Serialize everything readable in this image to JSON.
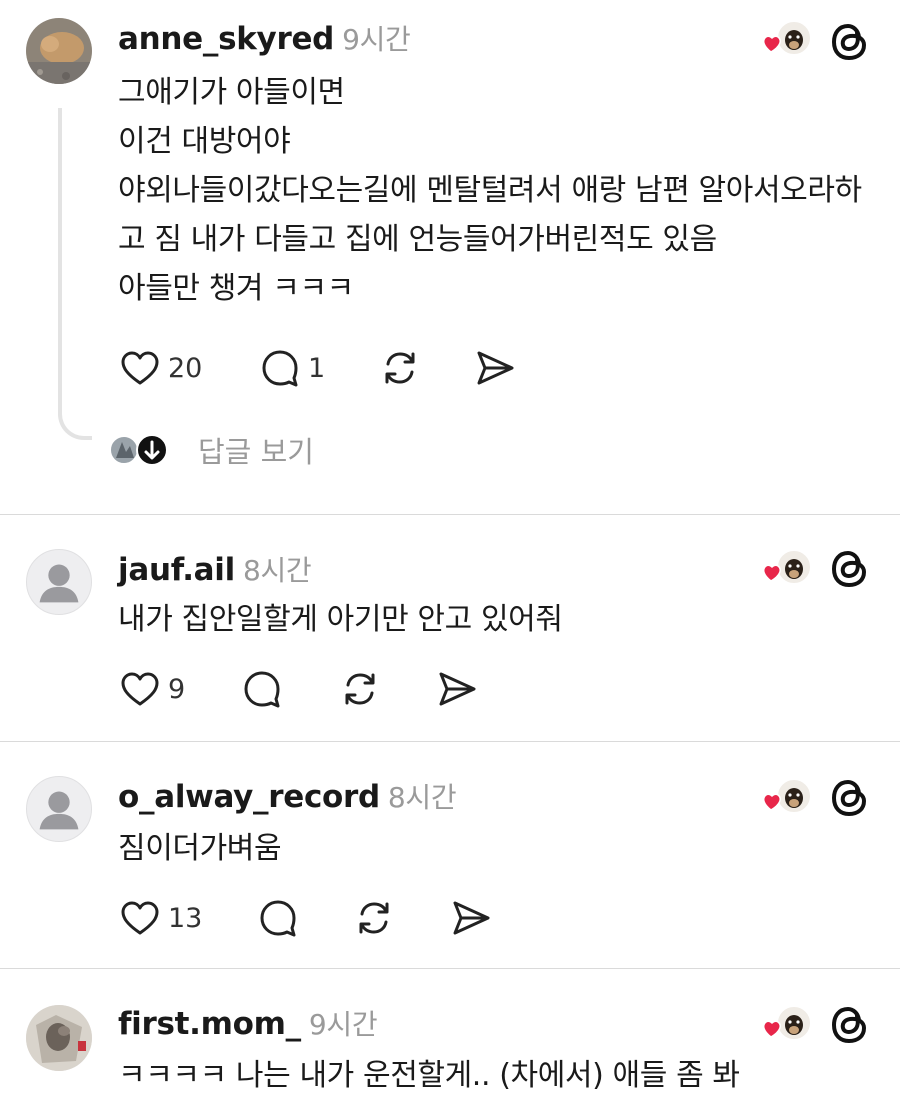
{
  "posts": [
    {
      "username": "anne_skyred",
      "time": "9시간",
      "text": "그애기가 아들이면\n이건 대방어야\n야외나들이갔다오는길에 멘탈털려서 애랑 남편 알아서오라하고 짐 내가 다들고 집에 언능들어가버린적도 있음\n아들만 챙겨 ㅋㅋㅋ",
      "likes": "20",
      "replies": "1",
      "view_replies_label": "답글 보기"
    },
    {
      "username": "jauf.ail",
      "time": "8시간",
      "text": "내가 집안일할게 아기만 안고 있어줘",
      "likes": "9",
      "replies": ""
    },
    {
      "username": "o_alway_record",
      "time": "8시간",
      "text": "짐이더가벼움",
      "likes": "13",
      "replies": ""
    },
    {
      "username": "first.mom_",
      "time": "9시간",
      "text": "ㅋㅋㅋㅋ 나는 내가 운전할게.. (차에서) 애들 좀 봐"
    }
  ],
  "icons": {
    "heart": "heart-icon",
    "comment": "comment-icon",
    "repost": "repost-icon",
    "share": "share-icon",
    "threads": "threads-logo-icon"
  },
  "colors": {
    "like_heart": "#e8264a",
    "muted_text": "#9a9a9a",
    "divider": "#dadada"
  }
}
